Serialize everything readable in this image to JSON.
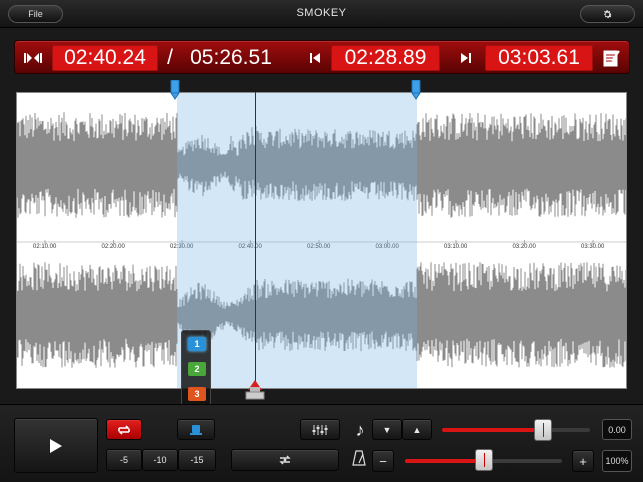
{
  "header": {
    "file_label": "File",
    "title": "SMOKEY",
    "settings_icon": "gear-icon"
  },
  "timebar": {
    "current_time": "02:40.24",
    "separator": "/",
    "total_time": "05:26.51",
    "start_time": "02:28.89",
    "end_time": "03:03.61",
    "icons": [
      "collapse-icon",
      "go-to-start-icon",
      "go-to-end-icon",
      "notes-icon"
    ]
  },
  "waveform": {
    "time_labels": [
      "02:10.00",
      "02:20.00",
      "02:30.00",
      "02:40.00",
      "02:50.00",
      "03:00.00",
      "03:10.00",
      "03:20.00",
      "03:30.00"
    ],
    "selection_start": "02:28.89",
    "selection_end": "03:03.61",
    "playhead": "02:40.24",
    "colors": {
      "wave": "#6e6e6e",
      "selection": "#a8cfee",
      "background": "#ffffff"
    }
  },
  "clips": [
    {
      "label": "1",
      "color": "#2a90d8"
    },
    {
      "label": "2",
      "color": "#4aa83a"
    },
    {
      "label": "3",
      "color": "#e0541e"
    }
  ],
  "controls": {
    "play_icon": "play-icon",
    "loop_icon": "loop-icon",
    "clip_icon": "clip-stack-icon",
    "skip_buttons": [
      "-5",
      "-10",
      "-15"
    ],
    "mixer_icon": "mixer-icon",
    "loop_edit_icon": "loop-edit-icon",
    "note_icon": "music-note-icon",
    "metronome_icon": "metronome-icon",
    "pitch_down": "▼",
    "pitch_up": "▲",
    "pitch_value": "0.00",
    "tempo_minus": "−",
    "tempo_plus": "+",
    "tempo_value": "100%",
    "pitch_level": 0.68,
    "tempo_level": 0.5
  }
}
